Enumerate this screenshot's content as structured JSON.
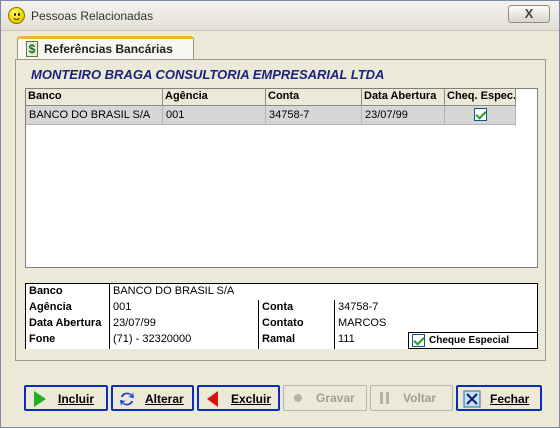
{
  "window": {
    "title": "Pessoas Relacionadas",
    "close_label": "X"
  },
  "tab": {
    "icon_glyph": "$",
    "label": "Referências Bancárias"
  },
  "company": "MONTEIRO BRAGA CONSULTORIA EMPRESARIAL LTDA",
  "grid": {
    "columns": [
      "Banco",
      "Agência",
      "Conta",
      "Data Abertura",
      "Cheq. Espec."
    ],
    "rows": [
      {
        "banco": "BANCO DO BRASIL S/A",
        "agencia": "001",
        "conta": "34758-7",
        "data_abertura": "23/07/99",
        "cheq_espec": true
      }
    ]
  },
  "form": {
    "banco_label": "Banco",
    "banco_value": "BANCO DO BRASIL S/A",
    "agencia_label": "Agência",
    "agencia_value": "001",
    "conta_label": "Conta",
    "conta_value": "34758-7",
    "data_label": "Data Abertura",
    "data_value": "23/07/99",
    "contato_label": "Contato",
    "contato_value": "MARCOS",
    "fone_label": "Fone",
    "fone_value": "(71) - 32320000",
    "ramal_label": "Ramal",
    "ramal_value": "111",
    "cheque_label": "Cheque Especial",
    "cheque_checked": true
  },
  "buttons": {
    "incluir": "Incluir",
    "alterar": "Alterar",
    "excluir": "Excluir",
    "gravar": "Gravar",
    "voltar": "Voltar",
    "fechar": "Fechar"
  },
  "colors": {
    "accent_tab": "#f5b72d",
    "company_text": "#1a237e",
    "button_border": "#0b2dbf"
  }
}
